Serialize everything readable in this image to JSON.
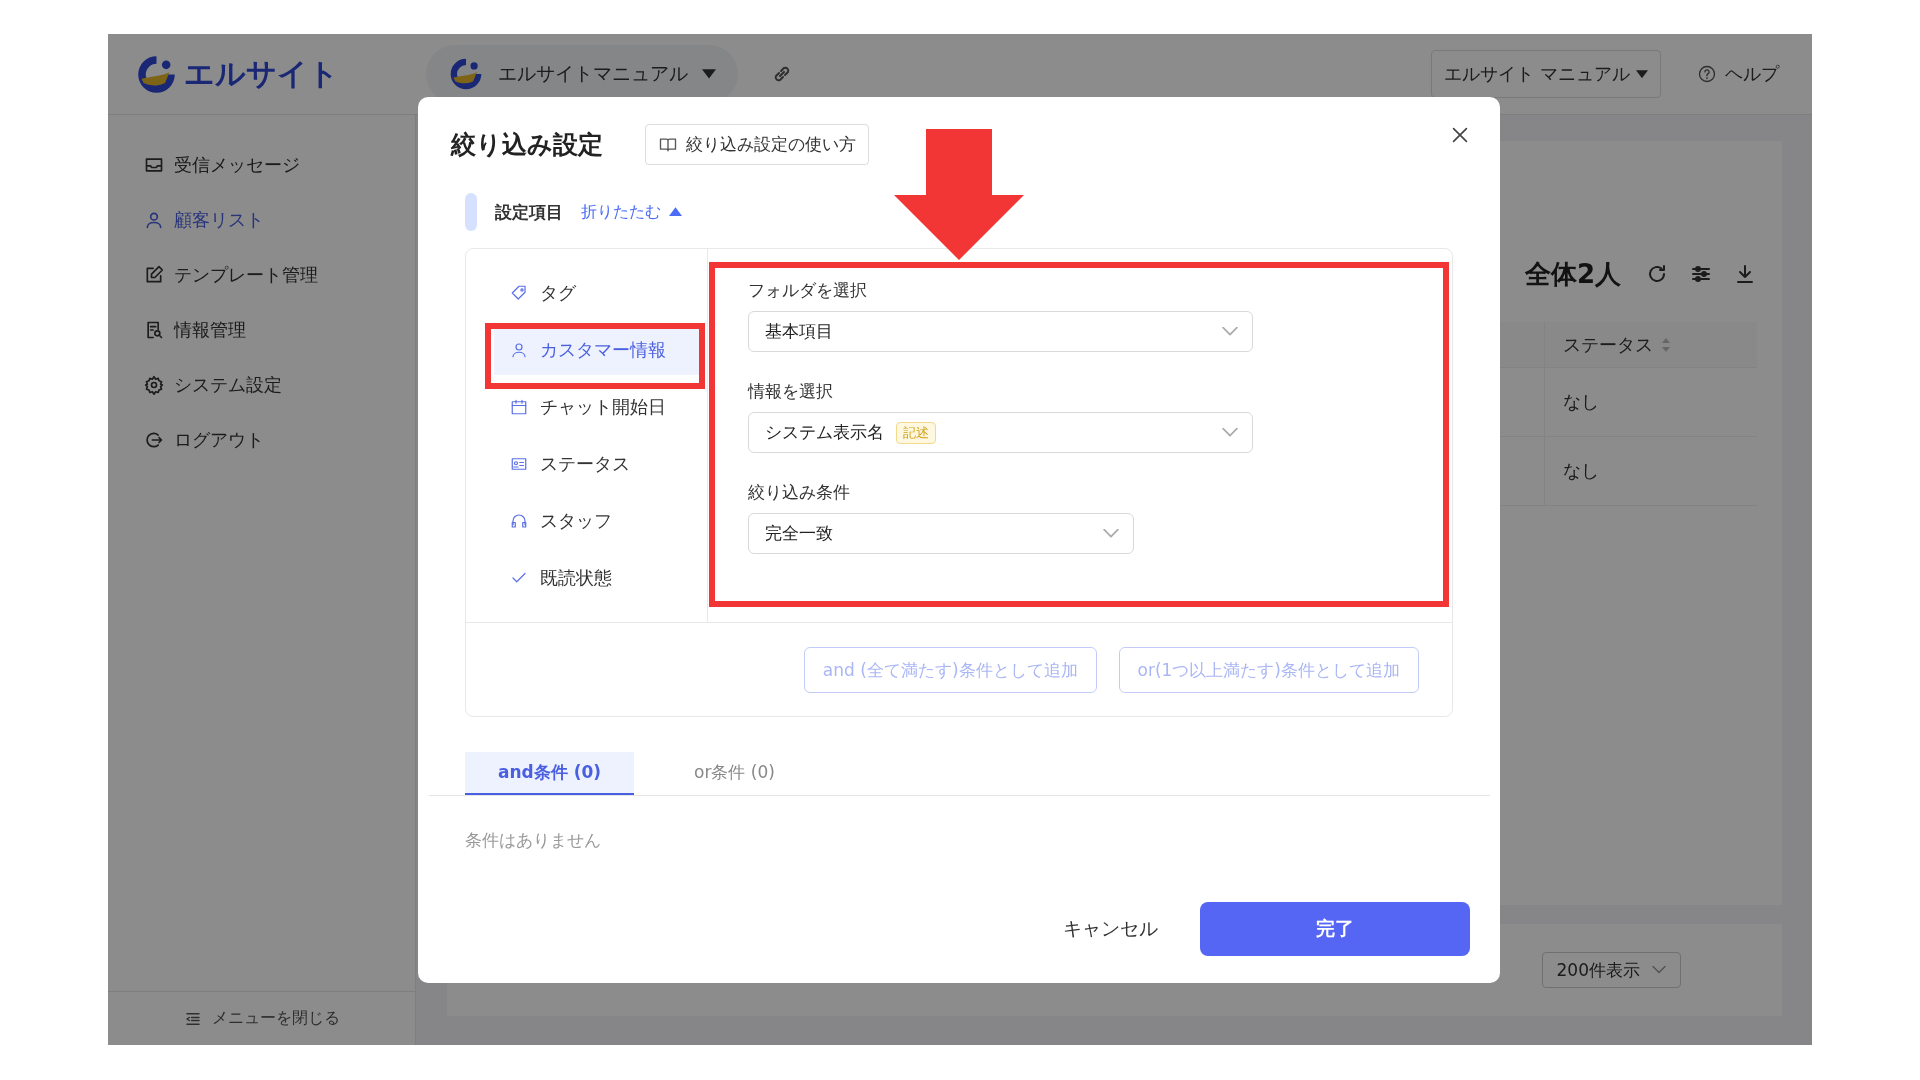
{
  "header": {
    "brand": "エルサイト",
    "workspace": "エルサイトマニュアル",
    "account": "エルサイト マニュアル",
    "help": "ヘルプ"
  },
  "sidebar": {
    "items": [
      {
        "label": "受信メッセージ",
        "kind": "inbox",
        "selected": false
      },
      {
        "label": "顧客リスト",
        "kind": "user",
        "selected": true
      },
      {
        "label": "テンプレート管理",
        "kind": "edit",
        "selected": false
      },
      {
        "label": "情報管理",
        "kind": "doc",
        "selected": false
      },
      {
        "label": "システム設定",
        "kind": "gear",
        "selected": false
      },
      {
        "label": "ログアウト",
        "kind": "logout",
        "selected": false
      }
    ],
    "collapse": "メニューを閉じる"
  },
  "main": {
    "total": "全体2人",
    "table": {
      "columns": [
        "ステータス"
      ],
      "rows": [
        [
          "なし"
        ],
        [
          "なし"
        ]
      ]
    },
    "page_size": "200件表示"
  },
  "dialog": {
    "title": "絞り込み設定",
    "guide_button": "絞り込み設定の使い方",
    "section_title": "設定項目",
    "collapse_link": "折りたたむ",
    "categories": [
      {
        "label": "タグ",
        "kind": "tag",
        "selected": false
      },
      {
        "label": "カスタマー情報",
        "kind": "user",
        "selected": true
      },
      {
        "label": "チャット開始日",
        "kind": "calendar",
        "selected": false
      },
      {
        "label": "ステータス",
        "kind": "card",
        "selected": false
      },
      {
        "label": "スタッフ",
        "kind": "headset",
        "selected": false
      },
      {
        "label": "既読状態",
        "kind": "check",
        "selected": false
      }
    ],
    "fields": [
      {
        "label": "フォルダを選択",
        "value": "基本項目"
      },
      {
        "label": "情報を選択",
        "value": "システム表示名",
        "badge": "記述"
      },
      {
        "label": "絞り込み条件",
        "value": "完全一致"
      }
    ],
    "add_buttons": [
      {
        "label": "and (全て満たす)条件として追加",
        "disabled": true
      },
      {
        "label": "or(1つ以上満たす)条件として追加",
        "disabled": true
      }
    ],
    "tabs": [
      {
        "label": "and条件 (0)",
        "selected": true
      },
      {
        "label": "or条件 (0)",
        "selected": false
      }
    ],
    "empty_text": "条件はありません",
    "cancel": "キャンセル",
    "done": "完了"
  }
}
